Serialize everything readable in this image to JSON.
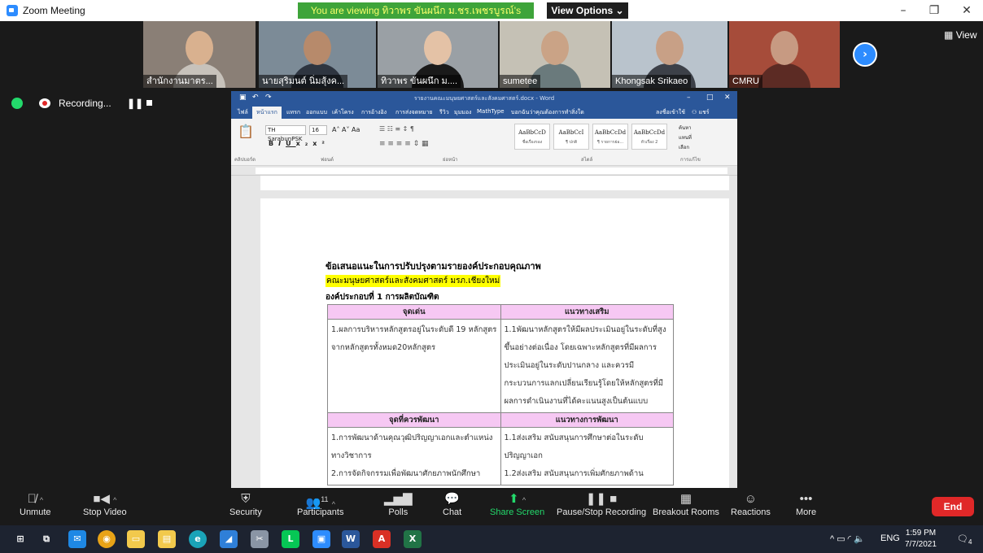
{
  "window": {
    "title": "Zoom Meeting",
    "viewing_banner": "You are viewing ทิวาพร ขันผนึก ม.ชร.เพชรบูรณ์'s screen",
    "view_options": "View Options",
    "minimize": "–",
    "maximize": "❐",
    "close": "✕"
  },
  "video_tiles": [
    {
      "name": "สำนักงานมาตร...",
      "bg": "#8a7f76",
      "skin": "#d9b18f",
      "shirt": "#c7c2bb"
    },
    {
      "name": "นายสุริมนต์ นิ่มสุ้งค...",
      "bg": "#7c8b97",
      "skin": "#b78a6b",
      "shirt": "#2e3540"
    },
    {
      "name": "ทิวาพร ขันผนึก ม....",
      "bg": "#9aa0a5",
      "skin": "#e4c2a6",
      "shirt": "#1a1a1a"
    },
    {
      "name": "sumetee",
      "bg": "#c5c1b5",
      "skin": "#caa386",
      "shirt": "#6a7a7c"
    },
    {
      "name": "Khongsak Srikaeo",
      "bg": "#b9c3cc",
      "skin": "#c8a086",
      "shirt": "#3c4048"
    },
    {
      "name": "CMRU",
      "bg": "#a64c3a",
      "skin": "#c79a82",
      "shirt": "#5c2b24"
    }
  ],
  "view_button": "View",
  "recording": {
    "label": "Recording...",
    "pause": "❚❚"
  },
  "word": {
    "doc_title": "รายงานคณะมนุษยศาสตร์และสังคมศาสตร์.docx - Word",
    "tabs": [
      "ไฟล์",
      "หน้าแรก",
      "แทรก",
      "ออกแบบ",
      "เค้าโครง",
      "การอ้างอิง",
      "การส่งจดหมาย",
      "รีวิว",
      "มุมมอง",
      "MathType",
      "บอกฉันว่าคุณต้องการทำสิ่งใด"
    ],
    "active_tab": "หน้าแรก",
    "sign_in": "ลงชื่อเข้าใช้",
    "share": "แชร์",
    "font_name": "TH SarabunPSK",
    "font_size": "16",
    "styles": [
      {
        "preview": "AaBbCcD",
        "name": "ชื่อเรื่องรอง"
      },
      {
        "preview": "AaBbCcI",
        "name": "¶ ปกติ"
      },
      {
        "preview": "AaBbCcDd",
        "name": "¶ รายการย่อ..."
      },
      {
        "preview": "AaBbCcDd",
        "name": "หัวเรื่อง 2"
      }
    ],
    "groups": [
      "คลิปบอร์ด",
      "ฟอนต์",
      "ย่อหน้า",
      "สไตล์",
      "การแก้ไข"
    ],
    "editing": [
      "ค้นหา",
      "แทนที่",
      "เลือก"
    ]
  },
  "document": {
    "heading": "ข้อเสนอแนะในการปรับปรุงตามรายองค์ประกอบคุณภาพ",
    "faculty": "คณะมนุษยศาสตร์และสังคมศาสตร์ มรภ.เชียงใหม่",
    "component": "องค์ประกอบที่ 1 การผลิตบัณฑิต",
    "table1": {
      "headers": [
        "จุดเด่น",
        "แนวทางเสริม"
      ],
      "left": "1.ผลการบริหารหลักสูตรอยู่ในระดับดี 19 หลักสูตร จากหลักสูตรทั้งหมด20หลักสูตร",
      "right": "1.1พัฒนาหลักสูตรให้มีผลประเมินอยู่ในระดับที่สูงขึ้นอย่างต่อเนื่อง โดยเฉพาะหลักสูตรที่มีผลการประเมินอยู่ในระดับปานกลาง และควรมีกระบวนการแลกเปลี่ยนเรียนรู้โดยให้หลักสูตรที่มีผลการดำเนินงานที่ได้คะแนนสูงเป็นต้นแบบ"
    },
    "table2": {
      "headers": [
        "จุดที่ควรพัฒนา",
        "แนวทางการพัฒนา"
      ],
      "left1": "1.การพัฒนาด้านคุณวุฒิปริญญาเอกและตำแหน่งทางวิชาการ",
      "left2": "2.การจัดกิจกรรมเพื่อพัฒนาศักยภาพนักศึกษา",
      "right1": "1.1ส่งเสริม สนับสนุนการศึกษาต่อในระดับปริญญาเอก",
      "right2": "1.2ส่งเสริม สนับสนุนการเพิ่มศักยภาพด้าน"
    }
  },
  "toolbar": {
    "unmute": "Unmute",
    "stop_video": "Stop Video",
    "security": "Security",
    "participants": "Participants",
    "participants_count": "11",
    "polls": "Polls",
    "chat": "Chat",
    "share_screen": "Share Screen",
    "pause_recording": "Pause/Stop Recording",
    "breakout_rooms": "Breakout Rooms",
    "reactions": "Reactions",
    "more": "More",
    "end": "End"
  },
  "taskbar": {
    "lang": "ENG",
    "time": "1:59 PM",
    "date": "7/7/2021",
    "notifications": "4"
  },
  "colors": {
    "zoom_blue": "#2d8cff",
    "banner_green": "#3ea43a",
    "end_red": "#e02828",
    "word_blue": "#2b579a",
    "table_header_pink": "#f6c8f3",
    "highlight_yellow": "#ffff00"
  }
}
